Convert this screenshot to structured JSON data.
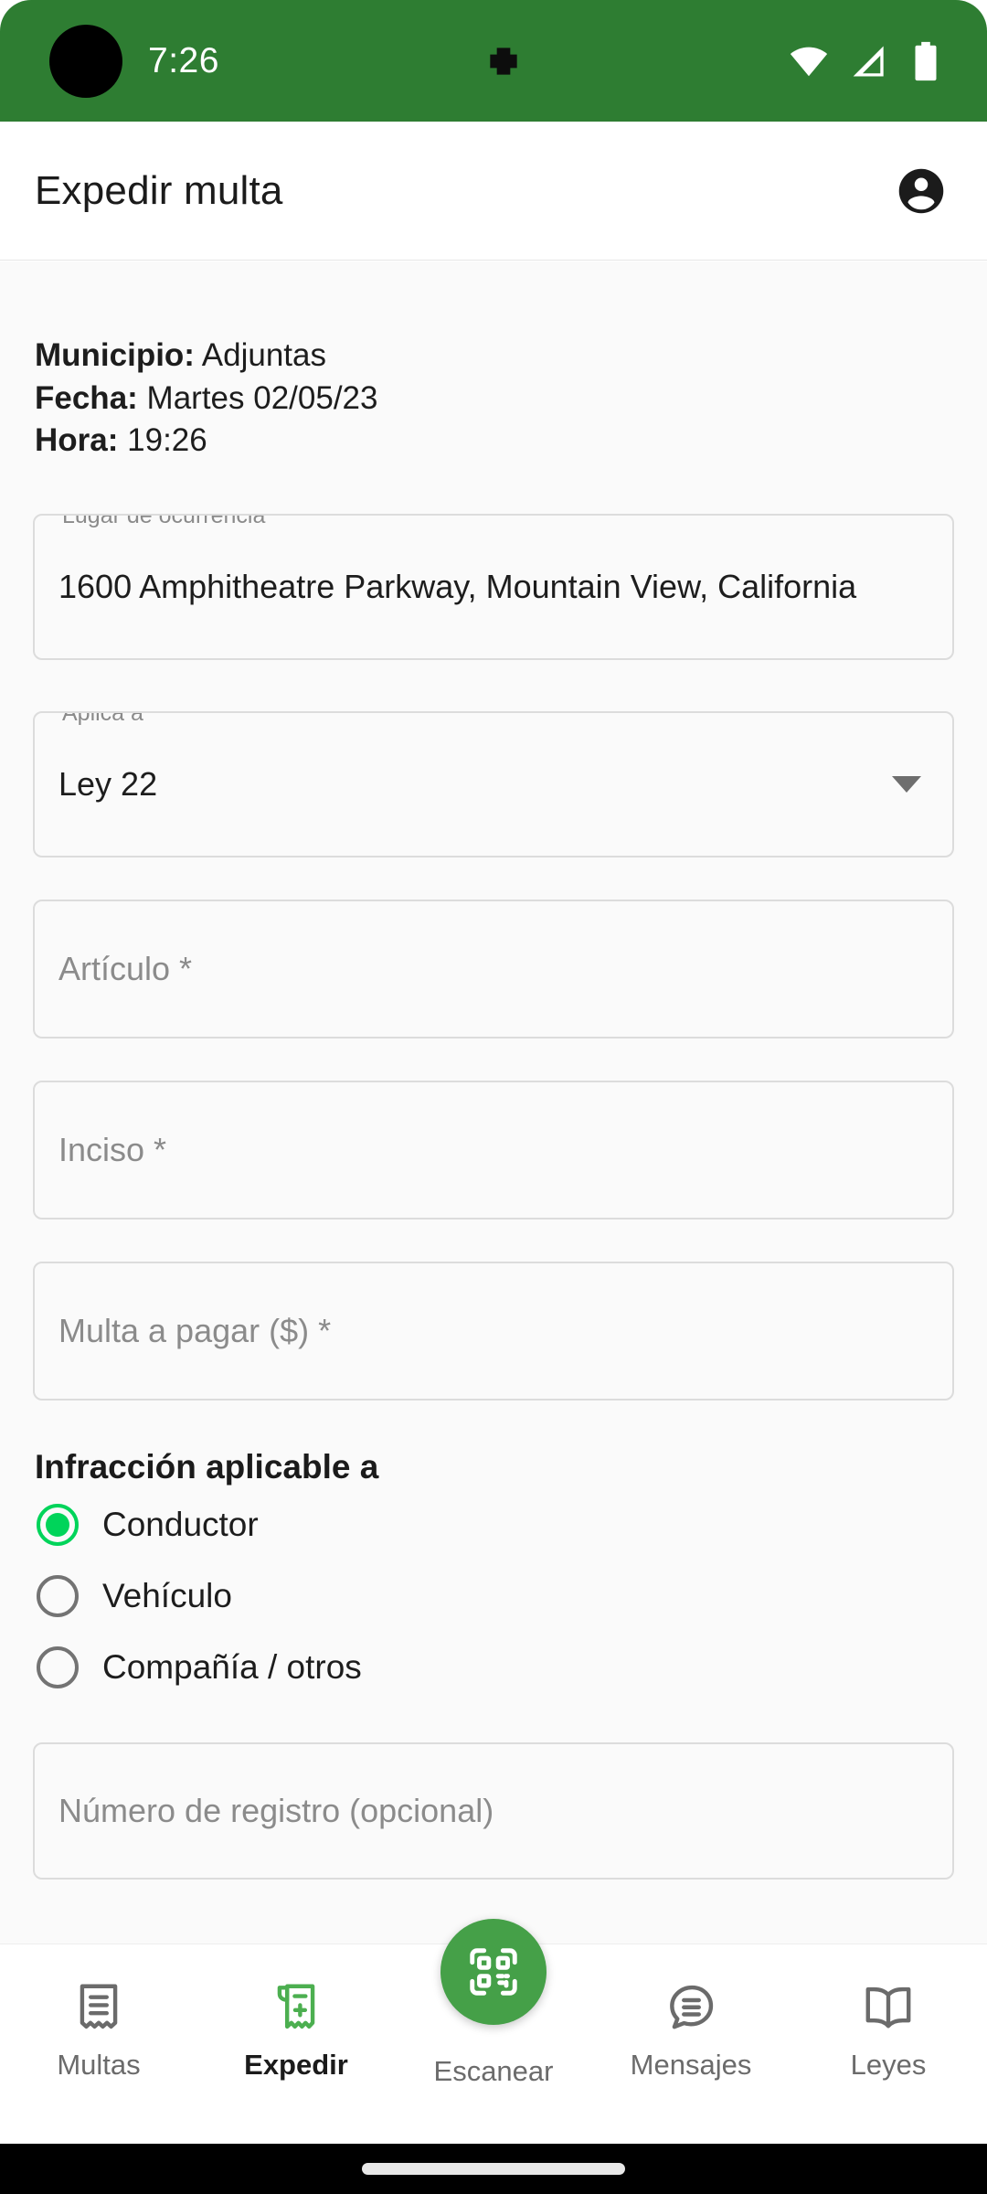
{
  "statusbar": {
    "time": "7:26",
    "icons": [
      "notification-icon",
      "wifi-icon",
      "cellular-signal-icon",
      "battery-icon"
    ]
  },
  "appbar": {
    "title": "Expedir multa",
    "account_icon": "account-circle-icon"
  },
  "info": {
    "municipio_label": "Municipio:",
    "municipio_value": "Adjuntas",
    "fecha_label": "Fecha:",
    "fecha_value": "Martes 02/05/23",
    "hora_label": "Hora:",
    "hora_value": "19:26"
  },
  "form": {
    "lugar": {
      "legend": "Lugar de ocurrencia *",
      "value": "1600 Amphitheatre Parkway, Mountain View, California"
    },
    "aplica_a": {
      "legend": "Aplica a *",
      "value": "Ley 22",
      "options": [
        "Ley 22"
      ]
    },
    "articulo": {
      "placeholder": "Artículo *",
      "value": ""
    },
    "inciso": {
      "placeholder": "Inciso *",
      "value": ""
    },
    "multa": {
      "placeholder": "Multa a pagar ($) *",
      "value": ""
    },
    "registro": {
      "placeholder": "Número de registro (opcional)",
      "value": ""
    }
  },
  "infraccion": {
    "title": "Infracción aplicable a",
    "options": [
      {
        "label": "Conductor",
        "selected": true
      },
      {
        "label": "Vehículo",
        "selected": false
      },
      {
        "label": "Compañía / otros",
        "selected": false
      }
    ]
  },
  "fab": {
    "icon": "qr-code-scan-icon"
  },
  "bottomnav": {
    "items": [
      {
        "label": "Multas",
        "icon": "receipt-icon",
        "active": false
      },
      {
        "label": "Expedir",
        "icon": "receipt-plus-icon",
        "active": true
      },
      {
        "label": "Escanear",
        "icon": "qr-code-scan-icon",
        "active": false
      },
      {
        "label": "Mensajes",
        "icon": "chat-bubble-icon",
        "active": false
      },
      {
        "label": "Leyes",
        "icon": "open-book-icon",
        "active": false
      }
    ]
  },
  "colors": {
    "statusbar_green": "#2e7d32",
    "fab_green": "#45a048",
    "accent_green": "#4caf50",
    "radio_green": "#00d45a",
    "content_bg": "#fafafa"
  }
}
